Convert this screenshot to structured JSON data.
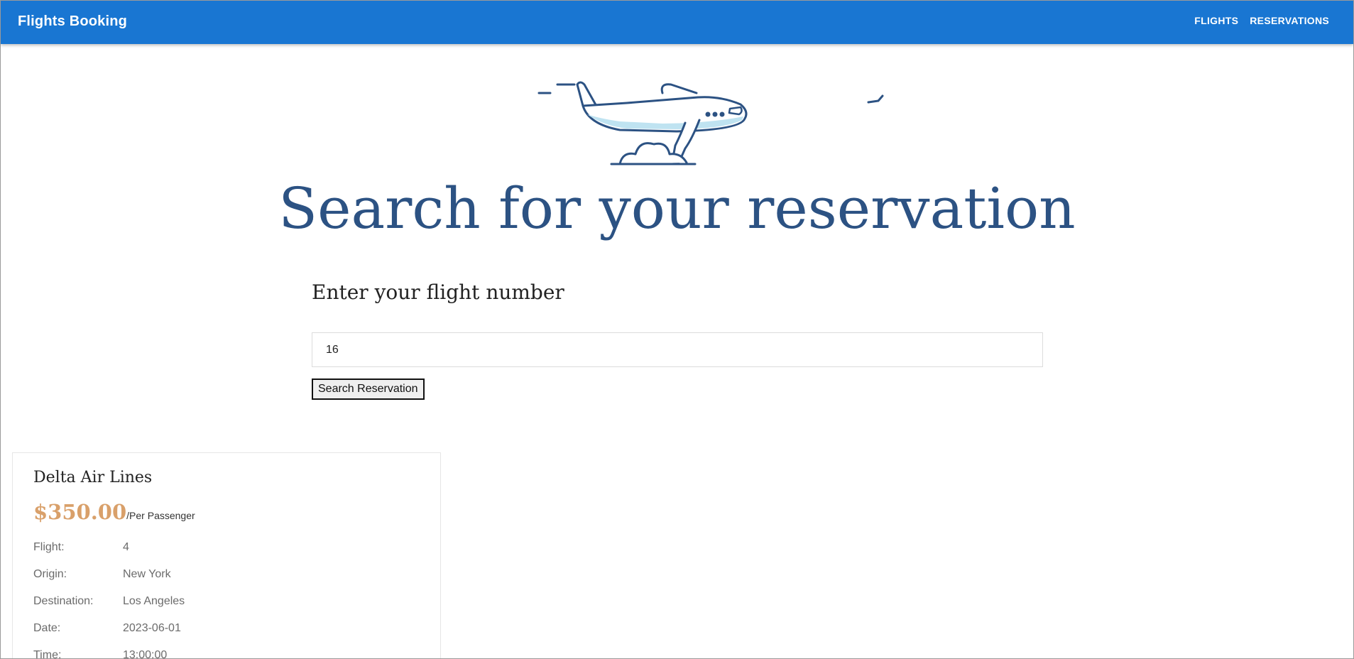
{
  "navbar": {
    "brand": "Flights Booking",
    "links": [
      "FLIGHTS",
      "RESERVATIONS"
    ]
  },
  "hero": {
    "title": "Search for your reservation"
  },
  "search_form": {
    "label": "Enter your flight number",
    "input_value": "16",
    "button_label": "Search Reservation"
  },
  "result_card": {
    "airline": "Delta Air Lines",
    "price": "$350.00",
    "price_suffix": "/Per Passenger",
    "details": [
      {
        "key": "Flight:",
        "value": "4"
      },
      {
        "key": "Origin:",
        "value": "New York"
      },
      {
        "key": "Destination:",
        "value": "Los Angeles"
      },
      {
        "key": "Date:",
        "value": "2023-06-01"
      },
      {
        "key": "Time:",
        "value": "13:00:00"
      }
    ]
  },
  "colors": {
    "navbar_bg": "#1976d2",
    "title": "#2c5283",
    "price": "#d9a06a"
  },
  "icons": [
    "airplane-illustration"
  ]
}
